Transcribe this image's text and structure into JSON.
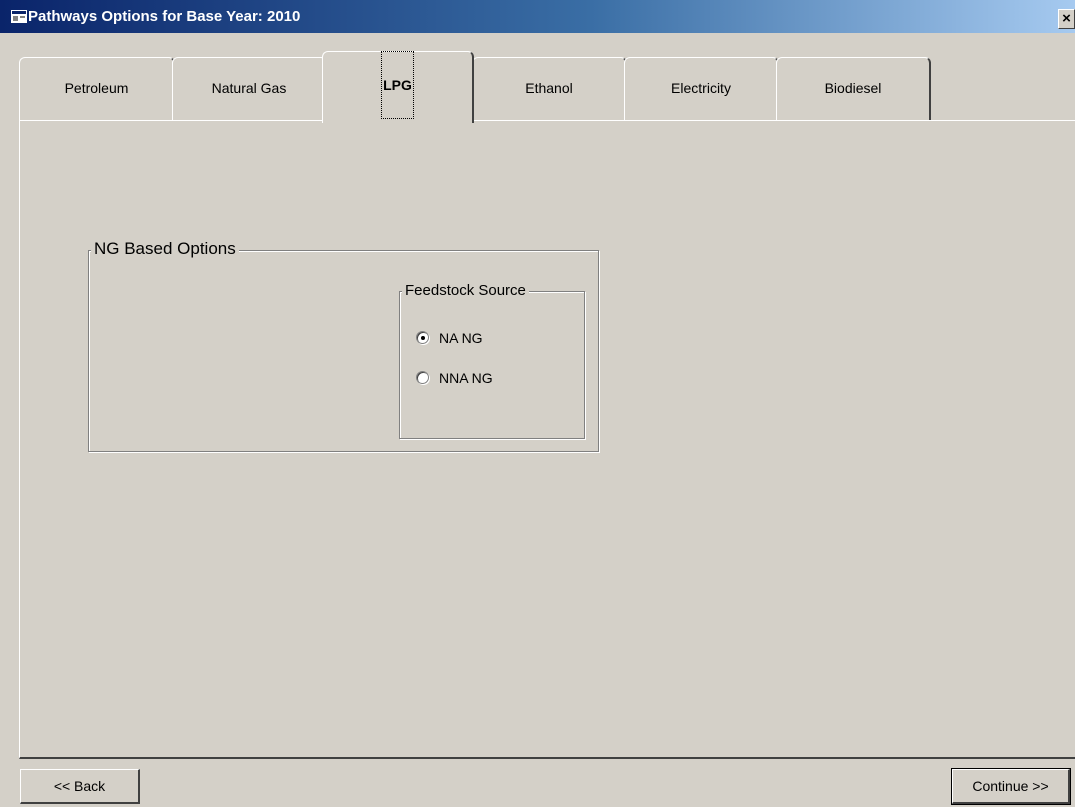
{
  "window": {
    "title": "Pathways Options for Base Year: 2010",
    "close_label": "×"
  },
  "tabs": [
    {
      "label": "Petroleum",
      "selected": false
    },
    {
      "label": "Natural Gas",
      "selected": false
    },
    {
      "label": "LPG",
      "selected": true
    },
    {
      "label": "Ethanol",
      "selected": false
    },
    {
      "label": "Electricity",
      "selected": false
    },
    {
      "label": "Biodiesel",
      "selected": false
    }
  ],
  "ng_options": {
    "title": "NG Based Options",
    "feedstock": {
      "title": "Feedstock Source",
      "options": [
        {
          "label": "NA NG",
          "checked": true
        },
        {
          "label": "NNA NG",
          "checked": false
        }
      ]
    }
  },
  "footer": {
    "back_label": "<< Back",
    "continue_label": "Continue >>"
  }
}
